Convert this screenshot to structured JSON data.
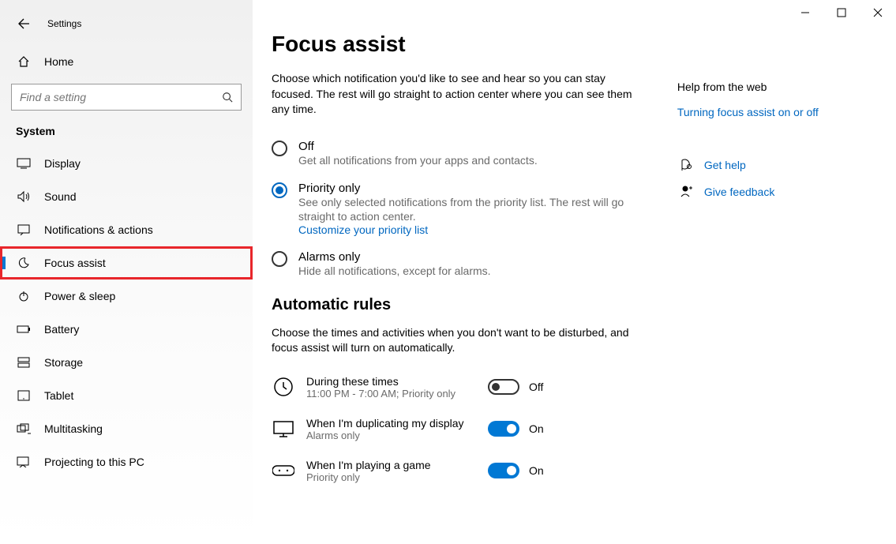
{
  "window_title": "Settings",
  "home_label": "Home",
  "search_placeholder": "Find a setting",
  "category": "System",
  "nav": [
    {
      "label": "Display"
    },
    {
      "label": "Sound"
    },
    {
      "label": "Notifications & actions"
    },
    {
      "label": "Focus assist"
    },
    {
      "label": "Power & sleep"
    },
    {
      "label": "Battery"
    },
    {
      "label": "Storage"
    },
    {
      "label": "Tablet"
    },
    {
      "label": "Multitasking"
    },
    {
      "label": "Projecting to this PC"
    }
  ],
  "page_title": "Focus assist",
  "page_desc": "Choose which notification you'd like to see and hear so you can stay focused. The rest will go straight to action center where you can see them any time.",
  "opts": [
    {
      "title": "Off",
      "sub": "Get all notifications from your apps and contacts."
    },
    {
      "title": "Priority only",
      "sub": "See only selected notifications from the priority list. The rest will go straight to action center.",
      "link": "Customize your priority list"
    },
    {
      "title": "Alarms only",
      "sub": "Hide all notifications, except for alarms."
    }
  ],
  "rules_heading": "Automatic rules",
  "rules_desc": "Choose the times and activities when you don't want to be disturbed, and focus assist will turn on automatically.",
  "rules": [
    {
      "title": "During these times",
      "sub": "11:00 PM - 7:00 AM; Priority only",
      "state": "Off"
    },
    {
      "title": "When I'm duplicating my display",
      "sub": "Alarms only",
      "state": "On"
    },
    {
      "title": "When I'm playing a game",
      "sub": "Priority only",
      "state": "On"
    }
  ],
  "aside": {
    "heading": "Help from the web",
    "link": "Turning focus assist on or off",
    "help": "Get help",
    "feedback": "Give feedback"
  }
}
